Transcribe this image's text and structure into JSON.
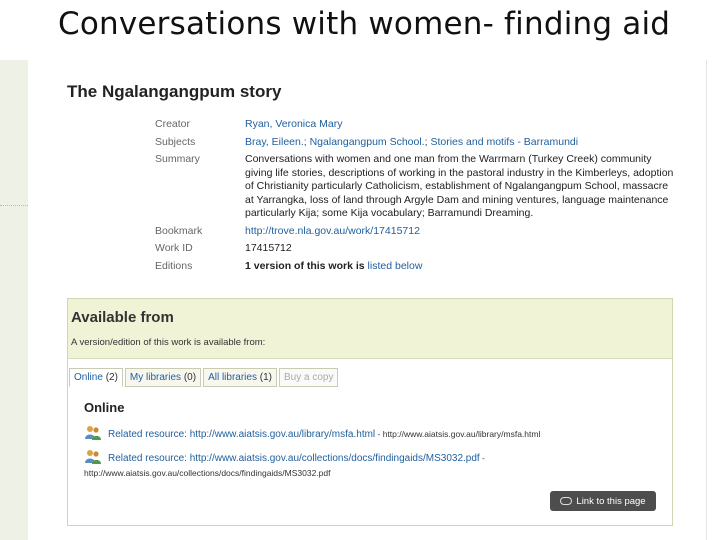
{
  "slide": {
    "title": "Conversations with women- finding aid"
  },
  "work": {
    "title": "The Ngalangangpum story",
    "fields": {
      "creator_label": "Creator",
      "creator_value": "Ryan, Veronica Mary",
      "subjects_label": "Subjects",
      "subjects": [
        "Bray, Eileen.",
        "Ngalangangpum School.",
        "Stories and motifs - Barramundi"
      ],
      "subjects_sep": ";",
      "summary_label": "Summary",
      "summary_value": "Conversations with women and one man from the Warrmarn (Turkey Creek) community giving life stories, descriptions of working in the pastoral industry in the Kimberleys, adoption of Christianity particularly Catholicism, establishment of Ngalangangpum School, massacre at Yarrangka, loss of land through Argyle Dam and mining ventures, language maintenance particularly Kija; some Kija vocabulary; Barramundi Dreaming.",
      "bookmark_label": "Bookmark",
      "bookmark_value": "http://trove.nla.gov.au/work/17415712",
      "workid_label": "Work ID",
      "workid_value": "17415712",
      "editions_label": "Editions",
      "editions_text": "1 version of this work is",
      "editions_link": "listed below"
    }
  },
  "available": {
    "title": "Available from",
    "subtitle": "A version/edition of this work is available from:",
    "tabs": [
      {
        "label": "Online",
        "count": "(2)"
      },
      {
        "label": "My libraries",
        "count": "(0)"
      },
      {
        "label": "All libraries",
        "count": "(1)"
      },
      {
        "label": "Buy a copy",
        "count": ""
      }
    ],
    "online_heading": "Online",
    "resources": [
      {
        "link": "Related resource: http://www.aiatsis.gov.au/library/msfa.html",
        "sep": " - ",
        "url": "http://www.aiatsis.gov.au/library/msfa.html"
      },
      {
        "link": "Related resource: http://www.aiatsis.gov.au/collections/docs/findingaids/MS3032.pdf",
        "sep": " - ",
        "url": "http://www.aiatsis.gov.au/collections/docs/findingaids/MS3032.pdf"
      }
    ],
    "link_button": "Link to this page"
  }
}
